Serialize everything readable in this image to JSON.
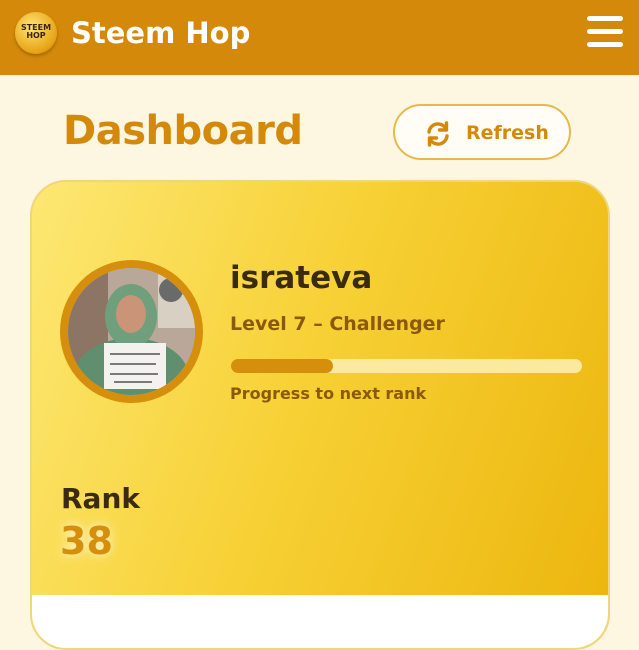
{
  "header": {
    "logo_lines": [
      "STEEM",
      "HOP"
    ],
    "app_title": "Steem Hop",
    "menu_icon": "hamburger-menu-icon"
  },
  "page": {
    "title": "Dashboard",
    "refresh_label": "Refresh",
    "refresh_icon": "refresh-icon"
  },
  "profile": {
    "username": "israteva",
    "level_text": "Level 7 – Challenger",
    "progress_fraction": 0.29,
    "progress_label": "Progress to next rank",
    "rank_label": "Rank",
    "rank_value": "38"
  },
  "colors": {
    "brand": "#d4890a",
    "card_gold": "#f7d136",
    "background": "#fdf7e2"
  }
}
